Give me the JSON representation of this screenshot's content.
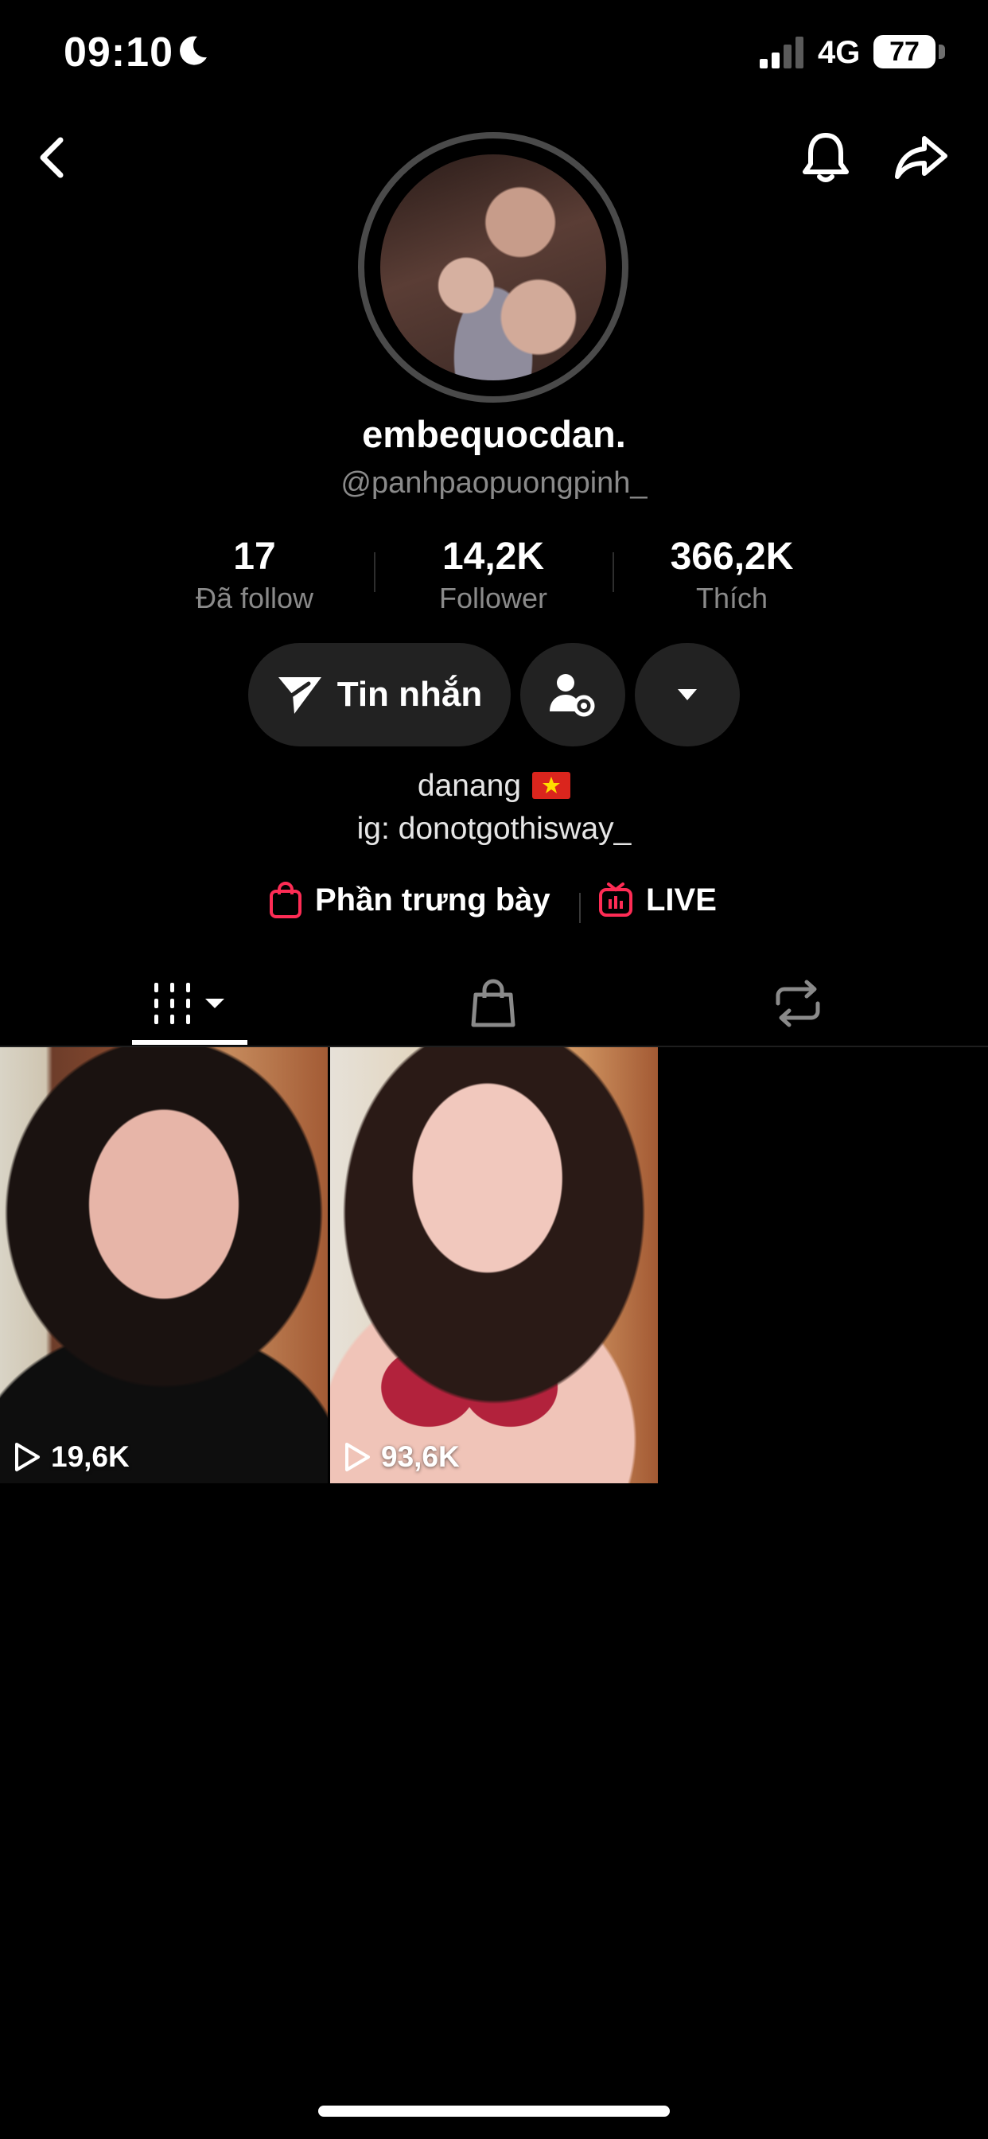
{
  "status_bar": {
    "time": "09:10",
    "network": "4G",
    "battery": "77"
  },
  "profile": {
    "display_name": "embequocdan.",
    "username": "@panhpaopuongpinh_",
    "stats": [
      {
        "value": "17",
        "label": "Đã follow"
      },
      {
        "value": "14,2K",
        "label": "Follower"
      },
      {
        "value": "366,2K",
        "label": "Thích"
      }
    ],
    "actions": {
      "message_label": "Tin nhắn"
    },
    "bio": {
      "line1": "danang",
      "line2": "ig: donotgothisway_"
    },
    "links": {
      "showcase_label": "Phần trưng bày",
      "live_label": "LIVE"
    }
  },
  "videos": [
    {
      "views": "19,6K"
    },
    {
      "views": "93,6K"
    }
  ],
  "colors": {
    "accent": "#fe2c55",
    "secondary_text": "#8a8a8a",
    "button_bg": "#222222"
  }
}
